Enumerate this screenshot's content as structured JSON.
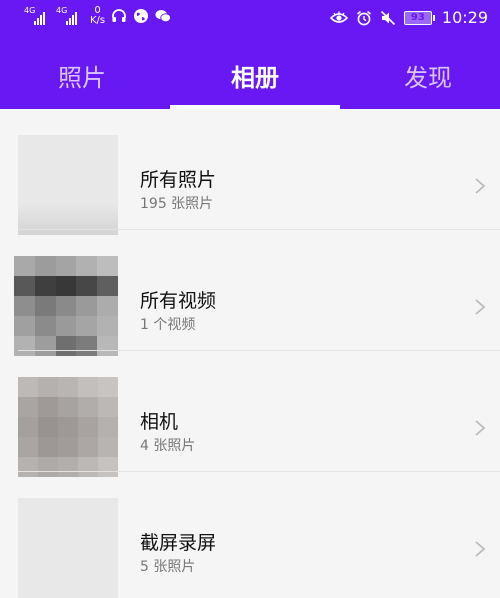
{
  "status": {
    "net1": "4G",
    "net2": "4G",
    "speed_value": "0",
    "speed_unit": "K/s",
    "battery": "93",
    "time": "10:29"
  },
  "tabs": [
    {
      "label": "照片",
      "active": false
    },
    {
      "label": "相册",
      "active": true
    },
    {
      "label": "发现",
      "active": false
    }
  ],
  "albums": [
    {
      "title": "所有照片",
      "subtitle": "195 张照片",
      "thumb": "blank"
    },
    {
      "title": "所有视频",
      "subtitle": "1 个视频",
      "thumb": "video"
    },
    {
      "title": "相机",
      "subtitle": "4 张照片",
      "thumb": "camera"
    },
    {
      "title": "截屏录屏",
      "subtitle": "5 张照片",
      "thumb": "blank"
    }
  ],
  "colors": {
    "header": "#6818f2",
    "background": "#f5f5f5"
  }
}
